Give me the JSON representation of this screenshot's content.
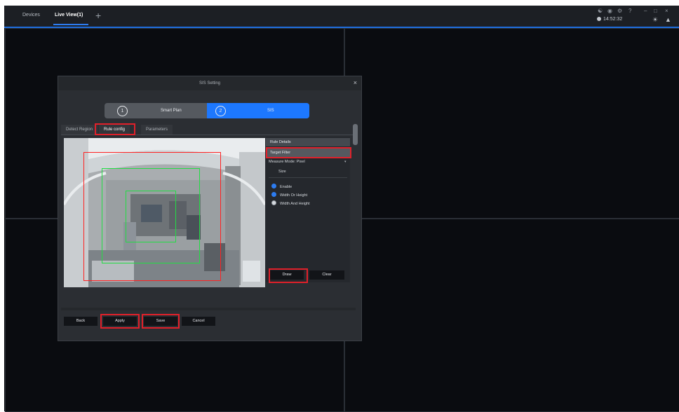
{
  "topbar": {
    "tabs": [
      "Devices",
      "Live View(1)"
    ],
    "add_tab": "+",
    "clock": "14:52:32"
  },
  "dialog": {
    "title": "SIS Setting",
    "close": "×",
    "steps": [
      {
        "num": "1",
        "label": "Smart Plan"
      },
      {
        "num": "2",
        "label": "SIS"
      }
    ],
    "subtabs": [
      "Detect Region",
      "Rule config",
      "Parameters"
    ],
    "panel": {
      "rule_details": "Rule Details",
      "target_filter": "Target Filter",
      "measure_mode": "Measure Mode:  Pixel",
      "size_label": "Size",
      "options": [
        "Enable",
        "Width Or Height",
        "Width And Height"
      ],
      "draw": "Draw",
      "clear": "Clear"
    },
    "buttons": {
      "back": "Back",
      "apply": "Apply",
      "save": "Save",
      "cancel": "Cancel"
    }
  },
  "colors": {
    "accent": "#1d78ff",
    "highlight": "#e0202a",
    "rule_box": "#22dd44",
    "detect_region": "#ff2222"
  }
}
